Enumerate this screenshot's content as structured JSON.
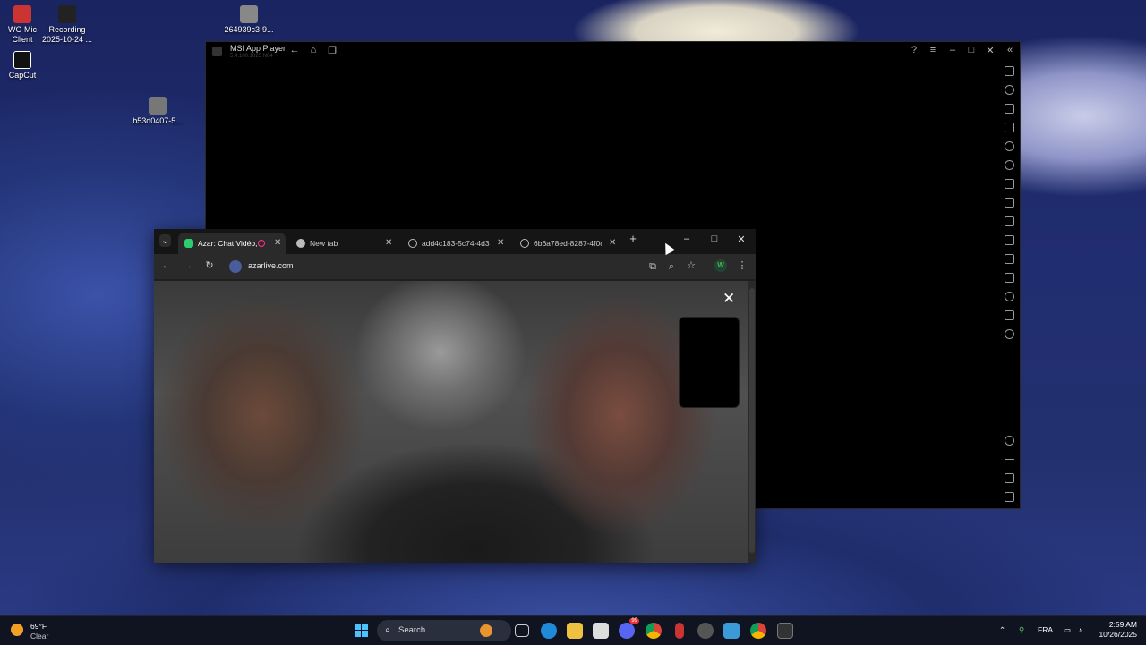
{
  "desktop": {
    "icons": [
      {
        "label_line1": "WO Mic",
        "label_line2": "Client"
      },
      {
        "label_line1": "Recording",
        "label_line2": "2025-10-24 ..."
      },
      {
        "label_line1": "264939c3-9...",
        "label_line2": ""
      },
      {
        "label_line1": "CapCut",
        "label_line2": ""
      },
      {
        "label_line1": "b53d0407-5...",
        "label_line2": ""
      }
    ]
  },
  "msi_window": {
    "title": "MSI App Player",
    "subtitle": "5.4.100.1025 N64",
    "controls": {
      "help": "?",
      "menu": "≡",
      "minimize": "–",
      "maximize": "□",
      "close": "✕",
      "collapse": "«"
    }
  },
  "chrome": {
    "tabs": [
      {
        "label": "Azar: Chat Vidéo,",
        "active": true,
        "recording": true
      },
      {
        "label": "New tab",
        "active": false
      },
      {
        "label": "add4c183-5c74-4d31",
        "active": false
      },
      {
        "label": "6b6a78ed-8287-4f0c",
        "active": false
      }
    ],
    "new_tab": "+",
    "tab_close": "✕",
    "window_controls": {
      "minimize": "–",
      "maximize": "□",
      "close": "✕"
    },
    "url": "azarlive.com",
    "profile_initial": "W",
    "content_close": "✕"
  },
  "taskbar": {
    "weather_temp": "69°F",
    "weather_cond": "Clear",
    "search_label": "Search",
    "tray_lang": "FRA",
    "time": "2:59 AM",
    "date": "10/26/2025",
    "discord_badge": "99"
  }
}
